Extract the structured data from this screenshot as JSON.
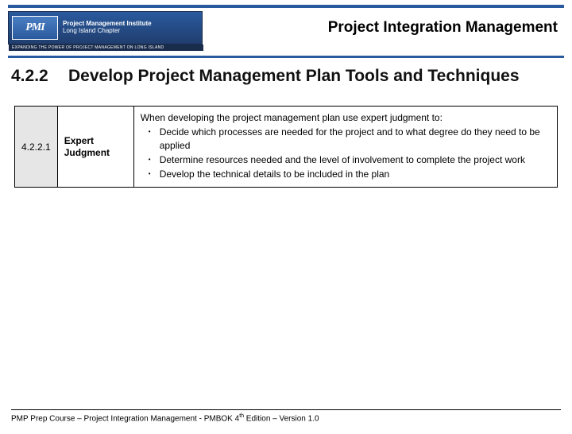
{
  "logo": {
    "badge": "PMI",
    "line1": "Project Management Institute",
    "line2": "Long Island Chapter",
    "tagline": "EXPANDING THE POWER OF PROJECT MANAGEMENT ON LONG ISLAND"
  },
  "header": {
    "title": "Project Integration Management"
  },
  "subtitle": {
    "number": "4.2.2",
    "text": "Develop Project Management Plan Tools and Techniques"
  },
  "row": {
    "num": "4.2.2.1",
    "name": "Expert Judgment",
    "intro": "When developing the project management plan use expert judgment to:",
    "bullets": [
      "Decide which processes are needed for the project and to what degree do they need to be applied",
      "Determine resources needed and the level of involvement to complete the project work",
      "Develop the technical details to be included in the plan"
    ]
  },
  "footer": {
    "pre": "PMP Prep Course – Project Integration Management - PMBOK 4",
    "sup": "th",
    "post": " Edition – Version 1.0"
  }
}
